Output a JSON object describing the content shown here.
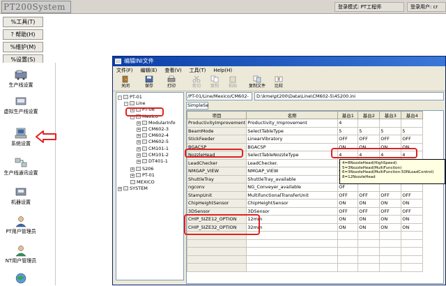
{
  "app": {
    "title": "PT200System",
    "mode_label": "登录模式: PT工程师",
    "user_label": "登录用户: cr"
  },
  "side_menu": [
    {
      "label": "%工具(T)",
      "icon": "tools-icon"
    },
    {
      "label": "? 帮助(H)",
      "icon": "help-icon"
    },
    {
      "label": "%维护(M)",
      "icon": "maintenance-icon"
    },
    {
      "label": "%设置(S)",
      "icon": "settings-icon"
    }
  ],
  "nav": [
    {
      "label": "生产线设置",
      "icon": "production-line-icon"
    },
    {
      "label": "虚拟生产线设置",
      "icon": "virtual-line-icon"
    },
    {
      "label": "系统设置",
      "icon": "system-settings-icon"
    },
    {
      "label": "生产线通讯设置",
      "icon": "line-comm-icon"
    },
    {
      "label": "机器设置",
      "icon": "machine-settings-icon"
    },
    {
      "label": "PT用户管理员",
      "icon": "pt-user-admin-icon"
    },
    {
      "label": "NT用户管理员",
      "icon": "nt-user-admin-icon"
    }
  ],
  "dialog": {
    "title": "编辑INI文件",
    "menu": [
      "文件(F)",
      "编辑(E)",
      "查看(V)",
      "工具(T)",
      "Help(H)"
    ],
    "toolbar": [
      {
        "label": "关闭",
        "icon": "close-door-icon",
        "enabled": true
      },
      {
        "label": "保存",
        "icon": "save-icon",
        "enabled": true
      },
      {
        "label": "打印",
        "icon": "print-icon",
        "enabled": true
      },
      {
        "label": "剪切",
        "icon": "cut-icon",
        "enabled": false
      },
      {
        "label": "复制",
        "icon": "copy-icon",
        "enabled": false
      },
      {
        "label": "粘贴",
        "icon": "paste-icon",
        "enabled": false
      },
      {
        "label": "复制文件",
        "icon": "copy-file-icon",
        "enabled": true
      },
      {
        "label": "比较",
        "icon": "compare-icon",
        "enabled": true
      }
    ],
    "tree": [
      {
        "label": "PT-01",
        "level": 0,
        "exp": "-"
      },
      {
        "label": "Line",
        "level": 1,
        "exp": "-"
      },
      {
        "label": "PT-06",
        "level": 2,
        "exp": "+"
      },
      {
        "label": "Mexico",
        "level": 2,
        "exp": "-"
      },
      {
        "label": "ModularInfo",
        "level": 3,
        "exp": "+"
      },
      {
        "label": "CM602-3",
        "level": 3,
        "exp": "+"
      },
      {
        "label": "CM602-4",
        "level": 3,
        "exp": "+"
      },
      {
        "label": "CM602-5",
        "level": 3,
        "exp": "+"
      },
      {
        "label": "CM101-1",
        "level": 3,
        "exp": "+"
      },
      {
        "label": "CM101-2",
        "level": 3,
        "exp": "+"
      },
      {
        "label": "DT401-1",
        "level": 3,
        "exp": "+"
      },
      {
        "label": "S206",
        "level": 2,
        "exp": "+"
      },
      {
        "label": "PT-01",
        "level": 2,
        "exp": "+"
      },
      {
        "label": "MEXICO",
        "level": 2,
        "exp": ""
      },
      {
        "label": "SYSTEM",
        "level": 0,
        "exp": "+"
      }
    ],
    "path": "/PT-01/Line/Mexico/CM602-",
    "file": "D:\\kme\\pt200\\Data\\Line\\CM602-5\\45200.ini",
    "section": "SimpleSe",
    "columns": [
      "项目",
      "名称",
      "基台1",
      "基台2",
      "基台3",
      "基台4"
    ],
    "rows": [
      [
        "ProductivityImprovement",
        "Productivity_Improvement",
        "4",
        "",
        "",
        ""
      ],
      [
        "BeamMode",
        "SelectTableType",
        "5",
        "5",
        "5",
        "5"
      ],
      [
        "StickFeeder",
        "LinearVibratory",
        "OFF",
        "OFF",
        "OFF",
        "OFF"
      ],
      [
        "BGACSP",
        "BGACSP",
        "ON",
        "ON",
        "ON",
        "ON"
      ],
      [
        "NozzleHead",
        "SelectTableNozzleType",
        "4",
        "4",
        "4",
        "4"
      ],
      [
        "LeadChecker",
        "LeadChecker.",
        "OF",
        "",
        "",
        ""
      ],
      [
        "NMGAP_VIEW",
        "NMGAP_VIEW",
        "OF",
        "",
        "",
        ""
      ],
      [
        "ShuttleTray",
        "ShuttleTray_available",
        "OF",
        "",
        "",
        ""
      ],
      [
        "ngconv",
        "NG_Conveyer_available",
        "OF",
        "",
        "",
        ""
      ],
      [
        "StampUnit",
        "MultifunctionalTransferUnit",
        "OFF",
        "OFF",
        "OFF",
        "OFF"
      ],
      [
        "ChipHeightSensor",
        "ChipHeightSensor",
        "ON",
        "ON",
        "ON",
        "ON"
      ],
      [
        "3DSensor",
        "3DSensor",
        "OFF",
        "OFF",
        "OFF",
        "OFF"
      ],
      [
        "CHIP_SIZE12_OPTION",
        "12mm",
        "ON",
        "ON",
        "ON",
        "ON"
      ],
      [
        "CHIP_SIZE32_OPTION",
        "32mm",
        "ON",
        "ON",
        "ON",
        "ON"
      ],
      [
        "",
        "",
        "",
        "",
        "",
        ""
      ],
      [
        "",
        "",
        "",
        "",
        "",
        ""
      ],
      [
        "",
        "",
        "",
        "",
        "",
        ""
      ],
      [
        "",
        "",
        "",
        "",
        "",
        ""
      ],
      [
        "",
        "",
        "",
        "",
        "",
        ""
      ]
    ],
    "tooltip": [
      "4=8NozzleHead(HighSpeed)",
      "5=3NozzleHead(MultiFunction)",
      "6=3NozzleHead(MultiFunction:50NLoadControl)",
      "8=12NozzleHead"
    ]
  },
  "colors": {
    "highlight": "#e02020",
    "titlebar": "#0a3fa8",
    "dialog_bg": "#ece9d8"
  }
}
